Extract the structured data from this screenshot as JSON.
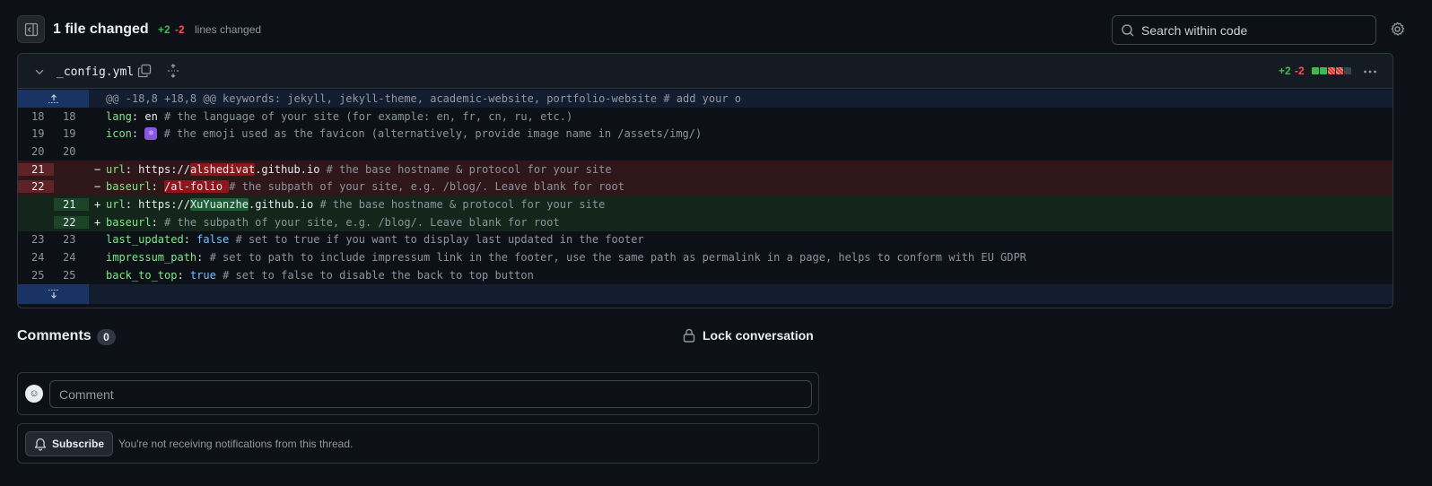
{
  "toolbar": {
    "files_changed": "1 file changed",
    "additions": "+2",
    "deletions": "-2",
    "lines_changed": "lines changed",
    "search_placeholder": "Search within code"
  },
  "file": {
    "name": "_config.yml",
    "additions": "+2",
    "deletions": "-2",
    "diffstat": [
      "add",
      "add",
      "del",
      "del",
      "neutral"
    ]
  },
  "diff": {
    "hunk_header": "@@ -18,8 +18,8 @@ keywords: jekyll, jekyll-theme, academic-website, portfolio-website # add your o",
    "lines": [
      {
        "old": "18",
        "new": "18",
        "marker": " ",
        "key": "lang",
        "sep": ": ",
        "value": "en",
        "rest": " # the language of your site (for example: en, fr, cn, ru, etc.)"
      },
      {
        "old": "19",
        "new": "19",
        "marker": " ",
        "key": "icon",
        "sep": ": ",
        "value": "⚛",
        "rest": " # the emoji used as the favicon (alternatively, provide image name in /assets/img/)"
      },
      {
        "old": "20",
        "new": "20",
        "marker": " ",
        "key": "",
        "sep": "",
        "value": "",
        "rest": ""
      },
      {
        "old": "21",
        "new": "",
        "marker": "−",
        "key": "url",
        "sep": ": ",
        "pre": "https://",
        "hl": "alshedivat",
        "post": ".github.io",
        "rest": " # the base hostname & protocol for your site"
      },
      {
        "old": "22",
        "new": "",
        "marker": "−",
        "key": "baseurl",
        "sep": ": ",
        "pre": "",
        "hl": "/al-folio ",
        "post": "",
        "rest": "# the subpath of your site, e.g. /blog/. Leave blank for root"
      },
      {
        "old": "",
        "new": "21",
        "marker": "+",
        "key": "url",
        "sep": ": ",
        "pre": "https://",
        "hl": "XuYuanzhe",
        "post": ".github.io",
        "rest": " # the base hostname & protocol for your site"
      },
      {
        "old": "",
        "new": "22",
        "marker": "+",
        "key": "baseurl",
        "sep": ": ",
        "pre": "",
        "hl": "",
        "post": "",
        "rest": "# the subpath of your site, e.g. /blog/. Leave blank for root"
      },
      {
        "old": "23",
        "new": "23",
        "marker": " ",
        "key": "last_updated",
        "sep": ": ",
        "value": "false",
        "rest": " # set to true if you want to display last updated in the footer"
      },
      {
        "old": "24",
        "new": "24",
        "marker": " ",
        "key": "impressum_path",
        "sep": ": ",
        "value": "",
        "rest": "# set to path to include impressum link in the footer, use the same path as permalink in a page, helps to conform with EU GDPR"
      },
      {
        "old": "25",
        "new": "25",
        "marker": " ",
        "key": "back_to_top",
        "sep": ": ",
        "value": "true",
        "rest": " # set to false to disable the back to top button"
      }
    ]
  },
  "comments": {
    "title": "Comments",
    "count": "0",
    "lock_label": "Lock conversation",
    "placeholder": "Comment",
    "subscribe_label": "Subscribe",
    "notify_text": "You're not receiving notifications from this thread."
  },
  "colors": {
    "add": "#3fb950",
    "del": "#f85149",
    "bg": "#0d1117"
  }
}
